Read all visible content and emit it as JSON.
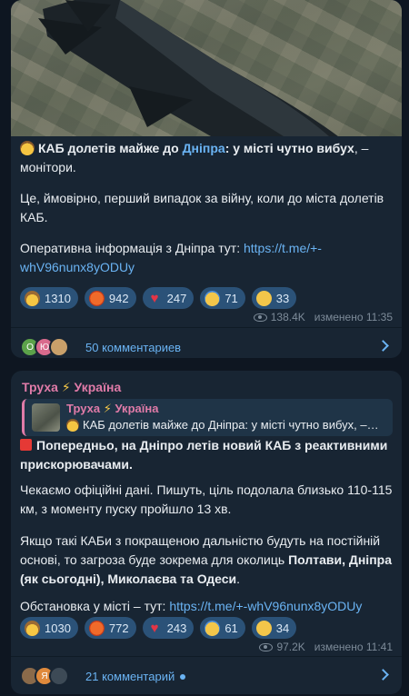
{
  "colors": {
    "background": "#0e1621",
    "bubble": "#182533",
    "link": "#6ab3f3",
    "reaction_bg": "#2b5278",
    "channel_name": "#e07ba8"
  },
  "post1": {
    "headline_bold_1": "КАБ долетів майже до ",
    "headline_link": "Дніпра",
    "headline_bold_2": ": у місті чутно вибух",
    "headline_rest": ", – монітори.",
    "para2": "Це, ймовірно, перший випадок за війну, коли до міста долетів КАБ.",
    "para3_prefix": "Оперативна інформація з Дніпра тут: ",
    "para3_link": "https://t.me/+-whV96nunx8yODUy",
    "reactions": [
      {
        "icon": "cowboy-face-icon",
        "count": "1310"
      },
      {
        "icon": "angry-face-icon",
        "count": "942"
      },
      {
        "icon": "heart-icon",
        "count": "247"
      },
      {
        "icon": "screaming-face-icon",
        "count": "71"
      },
      {
        "icon": "smirking-face-icon",
        "count": "33"
      }
    ],
    "views": "138.4K",
    "edited": "изменено 11:35",
    "avatars": [
      "О",
      "Ю",
      ""
    ],
    "comments": "50 комментариев"
  },
  "post2": {
    "author": "Труха",
    "author_country": "Україна",
    "quote_author": "Труха",
    "quote_country": "Україна",
    "quote_text": "КАБ долетів майже до Дніпра: у місті чутно вибух, – ...",
    "para1": "Попередньо, на Дніпро летів новий КАБ з реактивними прискорювачами.",
    "para2": "Чекаємо офіційні дані. Пишуть, ціль подолала близько 110-115 км, з моменту пуску пройшло 13 хв.",
    "para3_plain": "Якщо такі КАБи з покращеною дальністю будуть на постійній основі, то загроза буде зокрема для околиць ",
    "para3_bold": "Полтави, Дніпра (як сьогодні), Миколаєва та Одеси",
    "para3_end": ".",
    "para4_prefix": "Обстановка у місті – тут: ",
    "para4_link": "https://t.me/+-whV96nunx8yODUy",
    "reactions": [
      {
        "icon": "cowboy-face-icon",
        "count": "1030"
      },
      {
        "icon": "angry-face-icon",
        "count": "772"
      },
      {
        "icon": "heart-icon",
        "count": "243"
      },
      {
        "icon": "screaming-face-icon",
        "count": "61"
      },
      {
        "icon": "smirking-face-icon",
        "count": "34"
      }
    ],
    "views": "97.2K",
    "edited": "изменено 11:41",
    "avatars": [
      "",
      "Я",
      ""
    ],
    "comments": "21 комментарий"
  }
}
